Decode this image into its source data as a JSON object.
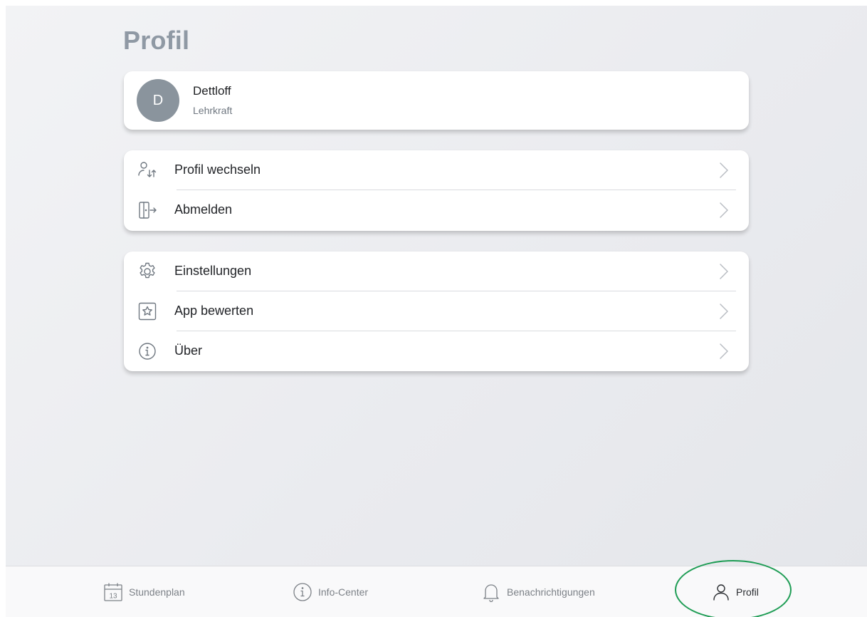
{
  "page": {
    "title": "Profil"
  },
  "profile": {
    "initial": "D",
    "name": "Dettloff",
    "role": "Lehrkraft"
  },
  "menu_group_1": [
    {
      "label": "Profil wechseln",
      "icon": "switch-profile-icon"
    },
    {
      "label": "Abmelden",
      "icon": "logout-door-icon"
    }
  ],
  "menu_group_2": [
    {
      "label": "Einstellungen",
      "icon": "gear-icon"
    },
    {
      "label": "App bewerten",
      "icon": "star-icon"
    },
    {
      "label": "Über",
      "icon": "info-icon"
    }
  ],
  "tabbar": {
    "items": [
      {
        "label": "Stundenplan",
        "icon": "calendar-icon",
        "calendar_day": "13"
      },
      {
        "label": "Info-Center",
        "icon": "info-icon"
      },
      {
        "label": "Benachrichtigungen",
        "icon": "bell-icon"
      },
      {
        "label": "Profil",
        "icon": "person-icon",
        "active": true
      }
    ]
  },
  "colors": {
    "title": "#8f99a4",
    "avatar_bg": "#8a949d",
    "highlight_ring": "#1f9d55",
    "tab_inactive": "#7c8187",
    "tab_active": "#2a2d31"
  }
}
